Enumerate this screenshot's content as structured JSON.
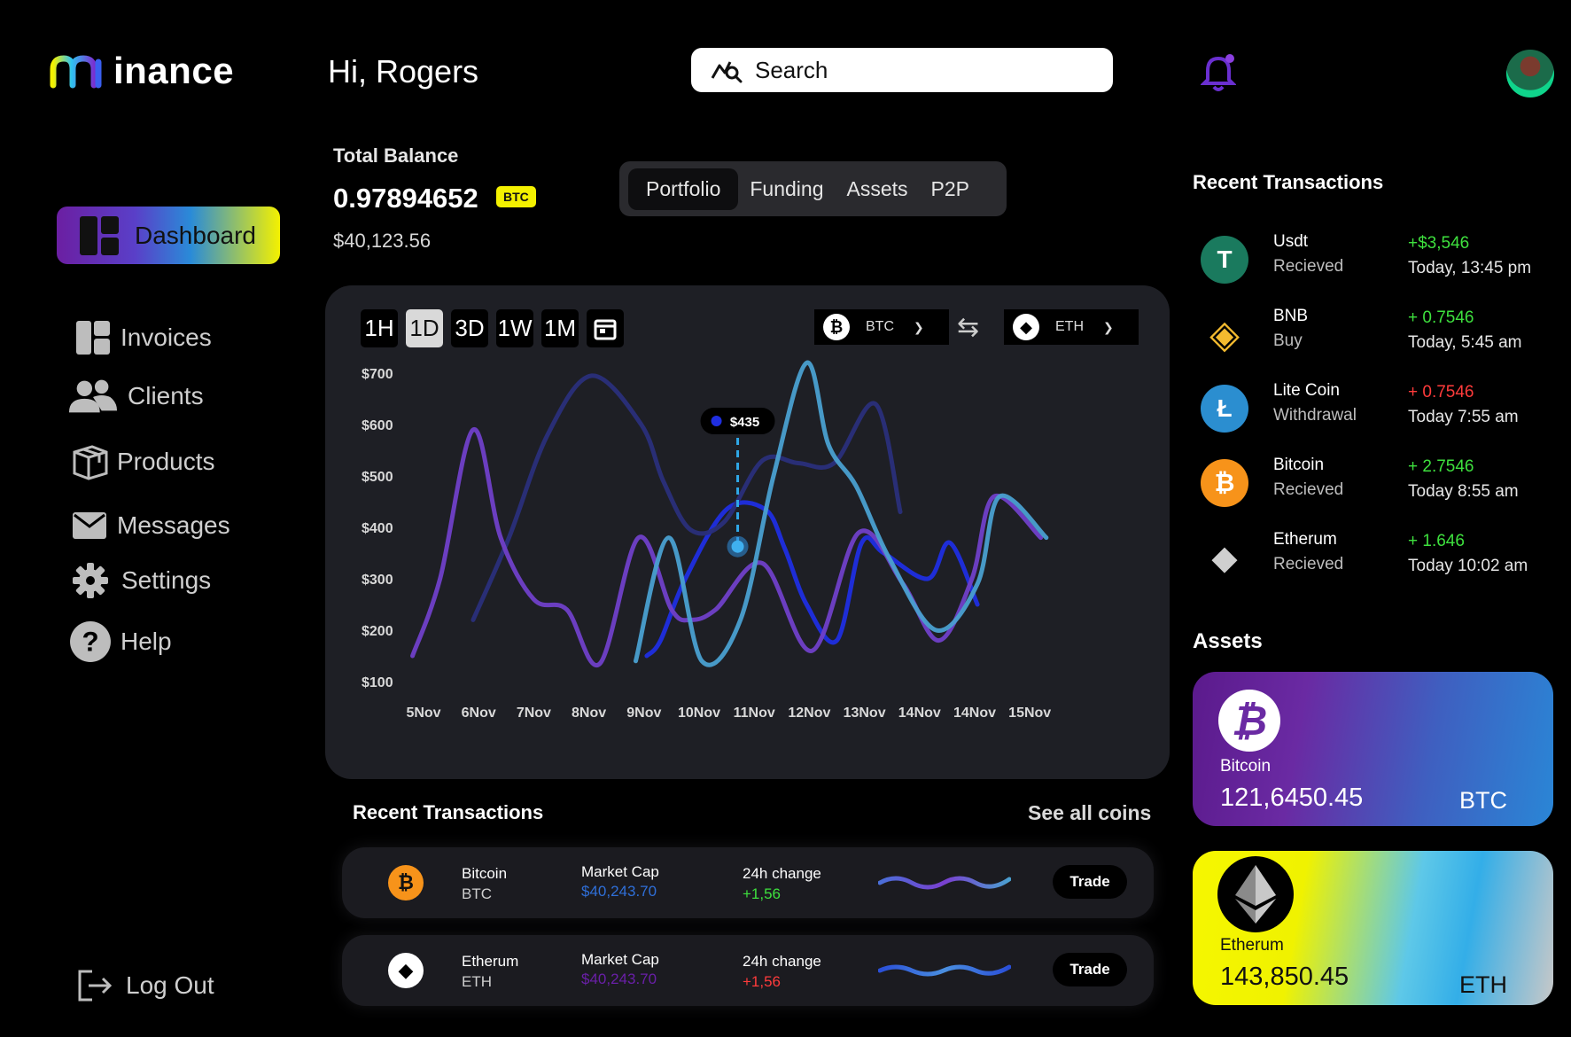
{
  "app": {
    "logo_text": "inance"
  },
  "header": {
    "greeting": "Hi, Rogers",
    "search_label": "Search"
  },
  "sidebar": {
    "dashboard_label": "Dashboard",
    "items": [
      {
        "label": "Invoices",
        "icon": "invoice-icon"
      },
      {
        "label": "Clients",
        "icon": "users-icon"
      },
      {
        "label": "Products",
        "icon": "box-icon"
      },
      {
        "label": "Messages",
        "icon": "mail-icon"
      },
      {
        "label": "Settings",
        "icon": "gear-icon"
      },
      {
        "label": "Help",
        "icon": "help-icon"
      }
    ],
    "logout_label": "Log Out"
  },
  "balance": {
    "title": "Total Balance",
    "btc_value": "0.97894652",
    "badge": "BTC",
    "usd_value": "$40,123.56"
  },
  "tabs": [
    "Portfolio",
    "Funding",
    "Assets",
    "P2P"
  ],
  "chart_controls": {
    "ranges": [
      "1H",
      "1D",
      "3D",
      "1W",
      "1M"
    ],
    "active_range": "1D",
    "from_coin": "BTC",
    "to_coin": "ETH"
  },
  "chart_data": {
    "type": "line",
    "categories": [
      "5Nov",
      "6Nov",
      "7Nov",
      "8Nov",
      "9Nov",
      "10Nov",
      "11Nov",
      "12Nov",
      "13Nov",
      "14Nov",
      "14Nov",
      "15Nov"
    ],
    "y_ticks": [
      "$700",
      "$600",
      "$500",
      "$400",
      "$300",
      "$200",
      "$100"
    ],
    "ylim": [
      100,
      700
    ],
    "tooltip": {
      "label": "$435",
      "value": 435,
      "x_index": 5.7
    },
    "series": [
      {
        "x": [
          4.05,
          4.3,
          4.75,
          5.5,
          6.2,
          6.55,
          6.95,
          7.5,
          7.95,
          8.35,
          9.15,
          9.55,
          10.05
        ],
        "values": [
          150,
          180,
          300,
          435,
          435,
          360,
          250,
          180,
          370,
          350,
          300,
          370,
          250
        ],
        "color": "#1f2ee0"
      },
      {
        "x": [
          0.9,
          1.55,
          2.25,
          3.05,
          3.95,
          4.35,
          4.85,
          5.45,
          6.15,
          6.8,
          7.45,
          8.2,
          8.65
        ],
        "values": [
          220,
          380,
          580,
          695,
          600,
          490,
          395,
          410,
          530,
          525,
          525,
          640,
          430
        ],
        "color": "#2a2f7a"
      },
      {
        "x": [
          -0.2,
          0.3,
          0.9,
          1.4,
          2.0,
          2.6,
          3.2,
          3.9,
          4.5,
          4.85,
          5.3,
          6.15,
          7.05,
          7.9,
          8.7,
          9.35,
          9.95,
          10.35,
          11.2
        ],
        "values": [
          150,
          300,
          590,
          380,
          260,
          240,
          135,
          380,
          240,
          220,
          240,
          330,
          160,
          390,
          290,
          180,
          300,
          460,
          380
        ],
        "color": "#7040c8"
      },
      {
        "x": [
          3.85,
          4.45,
          5.05,
          5.75,
          6.35,
          6.95,
          7.35,
          7.85,
          8.45,
          9.3,
          10.05,
          10.45,
          11.3
        ],
        "values": [
          140,
          380,
          140,
          220,
          500,
          720,
          560,
          480,
          340,
          200,
          290,
          460,
          380
        ],
        "color": "#4aa0d0"
      }
    ]
  },
  "recent_transactions": {
    "title": "Recent Transactions",
    "items": [
      {
        "name": "Usdt",
        "type": "Recieved",
        "amount": "+$3,546",
        "time": "Today, 13:45 pm",
        "sign": "pos",
        "icon": "tether-icon",
        "color": "#1a7a5e",
        "glyph": "T"
      },
      {
        "name": "BNB",
        "type": "Buy",
        "amount": "+ 0.7546",
        "time": "Today, 5:45 am",
        "sign": "pos",
        "icon": "bnb-icon",
        "color": "#000000",
        "glyph": "◈"
      },
      {
        "name": "Lite Coin",
        "type": "Withdrawal",
        "amount": "+ 0.7546",
        "time": "Today 7:55 am",
        "sign": "neg",
        "icon": "litecoin-icon",
        "color": "#2b8ed0",
        "glyph": "Ł"
      },
      {
        "name": "Bitcoin",
        "type": "Recieved",
        "amount": "+ 2.7546",
        "time": "Today 8:55 am",
        "sign": "pos",
        "icon": "bitcoin-icon",
        "color": "#f7931a",
        "glyph": "₿"
      },
      {
        "name": "Etherum",
        "type": "Recieved",
        "amount": "+ 1.646",
        "time": "Today 10:02 am",
        "sign": "pos",
        "icon": "ethereum-icon",
        "color": "#000000",
        "glyph": "◆"
      }
    ]
  },
  "assets": {
    "title": "Assets",
    "cards": [
      {
        "name": "Bitcoin",
        "value": "121,6450.45",
        "symbol": "BTC"
      },
      {
        "name": "Etherum",
        "value": "143,850.45",
        "symbol": "ETH"
      }
    ]
  },
  "bottom_transactions": {
    "title": "Recent Transactions",
    "see_all": "See all coins",
    "rows": [
      {
        "name": "Bitcoin",
        "symbol": "BTC",
        "market_cap_label": "Market Cap",
        "market_cap": "$40,243.70",
        "mc_color": "#2f6fd8",
        "change_label": "24h change",
        "change": "+1,56",
        "change_color": "#3ee03e",
        "trade": "Trade"
      },
      {
        "name": "Etherum",
        "symbol": "ETH",
        "market_cap_label": "Market Cap",
        "market_cap": "$40,243.70",
        "mc_color": "#6a1fa8",
        "change_label": "24h change",
        "change": "+1,56",
        "change_color": "#ff3b3b",
        "trade": "Trade"
      }
    ]
  }
}
